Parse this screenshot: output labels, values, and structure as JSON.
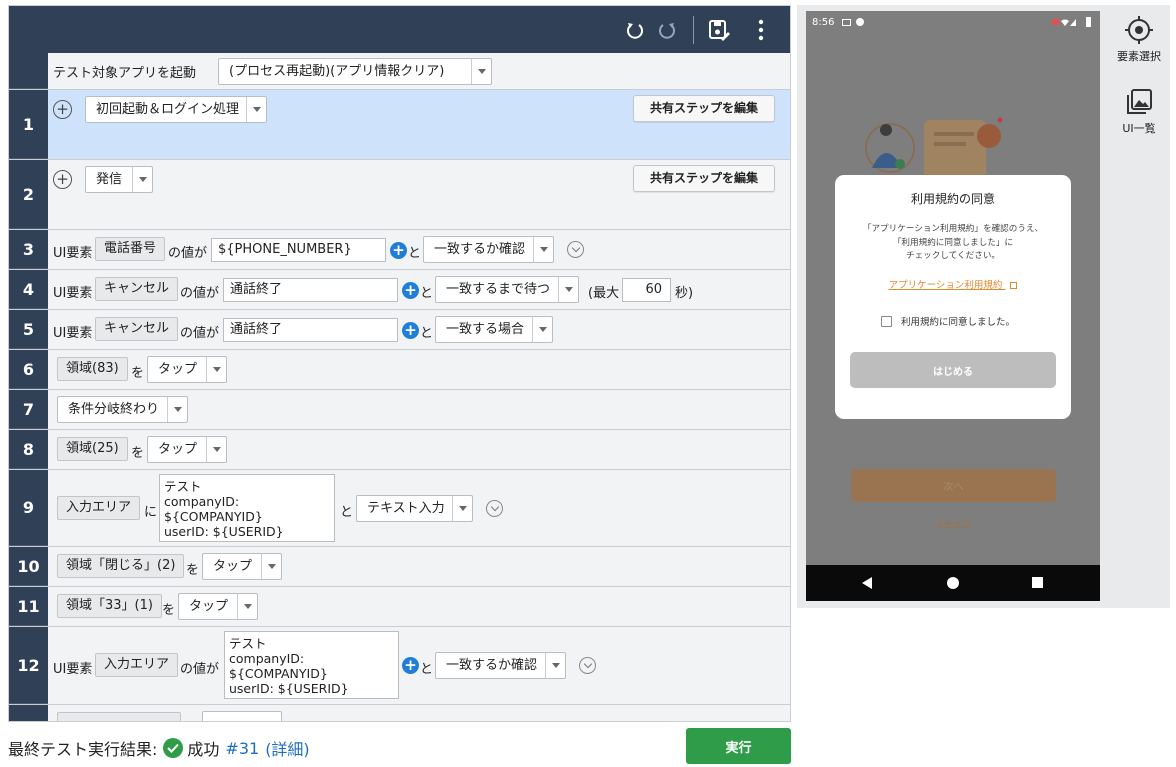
{
  "launch": {
    "label": "テスト対象アプリを起動",
    "mode": "(プロセス再起動)(アプリ情報クリア)"
  },
  "shared_button_label": "共有ステップを編集",
  "steps": {
    "s1": {
      "num": "1",
      "name": "初回起動＆ログイン処理"
    },
    "s2": {
      "num": "2",
      "name": "発信"
    },
    "s3": {
      "num": "3",
      "ui": "UI要素",
      "target": "電話番号",
      "of_value": "の値が",
      "value": "${PHONE_NUMBER}",
      "to": "と",
      "action": "一致するか確認"
    },
    "s4": {
      "num": "4",
      "ui": "UI要素",
      "target": "キャンセル",
      "of_value": "の値が",
      "value": "通話終了",
      "to": "と",
      "action": "一致するまで待つ",
      "max_label": "(最大",
      "max_value": "60",
      "sec": "秒)"
    },
    "s5": {
      "num": "5",
      "ui": "UI要素",
      "target": "キャンセル",
      "of_value": "の値が",
      "value": "通話終了",
      "to": "と",
      "action": "一致する場合"
    },
    "s6": {
      "num": "6",
      "target": "領域(83)",
      "wo": "を",
      "action": "タップ"
    },
    "s7": {
      "num": "7",
      "action": "条件分岐終わり"
    },
    "s8": {
      "num": "8",
      "target": "領域(25)",
      "wo": "を",
      "action": "タップ"
    },
    "s9": {
      "num": "9",
      "target": "入力エリア",
      "ni": "に",
      "text": "テスト\ncompanyID:\n${COMPANYID}\nuserID: ${USERID}",
      "to": "と",
      "action": "テキスト入力"
    },
    "s10": {
      "num": "10",
      "target": "領域「閉じる」(2)",
      "wo": "を",
      "action": "タップ"
    },
    "s11": {
      "num": "11",
      "target": "領域「33」(1)",
      "wo": "を",
      "action": "タップ"
    },
    "s12": {
      "num": "12",
      "ui": "UI要素",
      "target": "入力エリア",
      "of_value": "の値が",
      "text": "テスト\ncompanyID:\n${COMPANYID}\nuserID: ${USERID}",
      "to": "と",
      "action": "一致するか確認"
    }
  },
  "footer": {
    "label": "最終テスト実行結果:",
    "status": "成功",
    "run_id": "#31",
    "details": "(詳細)",
    "run_button": "実行"
  },
  "device": {
    "time": "8:56",
    "dialog_title": "利用規約の同意",
    "dialog_message_1": "「アプリケーション利用規約」を確認のうえ、",
    "dialog_message_2": "「利用規約に同意しました」に",
    "dialog_message_3": "チェックしてください。",
    "tos_link": "アプリケーション利用規約",
    "agree_label": "利用規約に同意しました。",
    "start_button": "はじめる",
    "next_button": "次へ",
    "skip_link": "スキップ"
  },
  "tools": {
    "select_element": "要素選択",
    "ui_list": "UI一覧"
  },
  "colors": {
    "header": "#2f4057",
    "selected_row": "#cfe2fb",
    "run_green": "#2e9c48",
    "link_blue": "#1f6fc0",
    "accent_orange": "#e08a2e"
  }
}
